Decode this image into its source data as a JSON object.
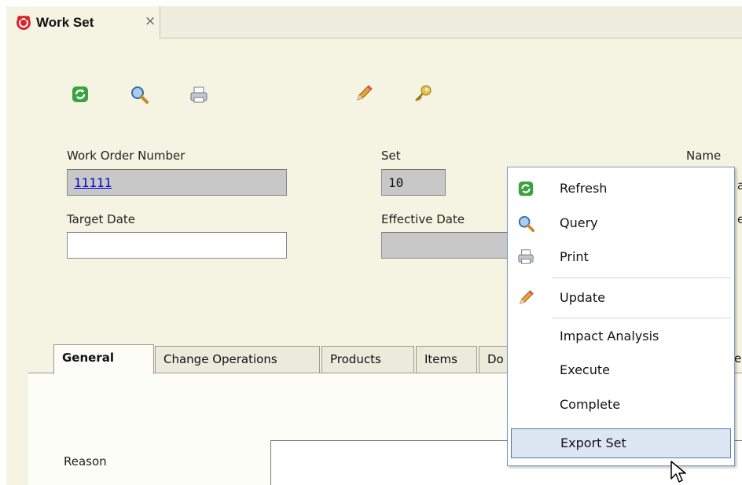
{
  "tab": {
    "title": "Work Set",
    "close": "×"
  },
  "toolbar": {
    "icons": [
      "refresh-icon",
      "query-icon",
      "print-icon",
      "update-icon",
      "key-icon"
    ]
  },
  "form": {
    "work_order_number": {
      "label": "Work Order Number",
      "value": "11111"
    },
    "set": {
      "label": "Set",
      "value": "10"
    },
    "name": {
      "label": "Name",
      "value_partial": "a"
    },
    "target_date": {
      "label": "Target Date",
      "value": ""
    },
    "effective_date": {
      "label": "Effective Date",
      "value": ""
    },
    "partial_right_label": "e"
  },
  "tabs": [
    "General",
    "Change Operations",
    "Products",
    "Items",
    "Do",
    "e"
  ],
  "active_tab": "General",
  "general": {
    "reason_label": "Reason"
  },
  "context_menu": {
    "items": [
      {
        "label": "Refresh",
        "icon": "refresh-icon"
      },
      {
        "label": "Query",
        "icon": "query-icon"
      },
      {
        "label": "Print",
        "icon": "print-icon"
      },
      {
        "label": "Update",
        "icon": "update-icon"
      },
      {
        "label": "Impact Analysis",
        "icon": ""
      },
      {
        "label": "Execute",
        "icon": ""
      },
      {
        "label": "Complete",
        "icon": ""
      },
      {
        "label": "Export Set",
        "icon": "",
        "highlighted": true
      }
    ]
  },
  "colors": {
    "background": "#f5f3e1",
    "menu_highlight": "#dde6f3",
    "menu_highlight_border": "#4f79b0",
    "link": "#0000cc"
  }
}
